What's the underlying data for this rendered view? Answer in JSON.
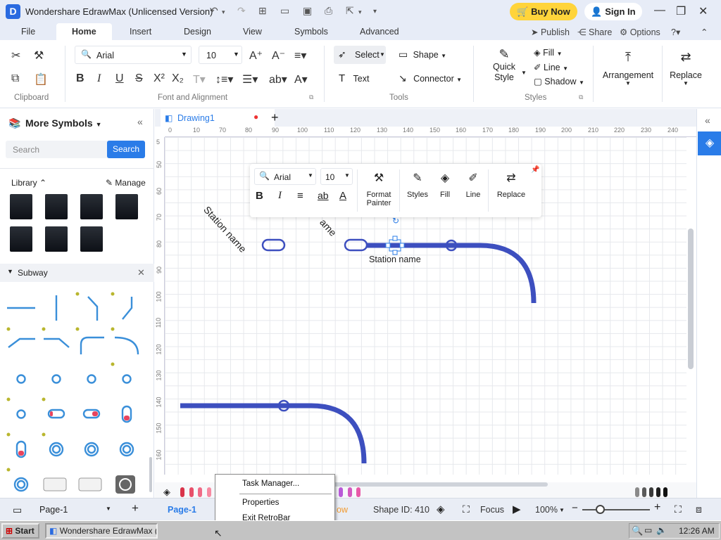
{
  "titlebar": {
    "app_title": "Wondershare EdrawMax (Unlicensed Version)",
    "buy_now": "Buy Now",
    "sign_in": "Sign In"
  },
  "menu": {
    "tabs": [
      "File",
      "Home",
      "Insert",
      "Design",
      "View",
      "Symbols",
      "Advanced"
    ],
    "active": "Home",
    "publish": "Publish",
    "share": "Share",
    "options": "Options"
  },
  "ribbon": {
    "font_name": "Arial",
    "font_size": "10",
    "select": "Select",
    "shape": "Shape",
    "text": "Text",
    "connector": "Connector",
    "quick_style": "Quick Style",
    "fill": "Fill",
    "line": "Line",
    "shadow": "Shadow",
    "arrangement": "Arrangement",
    "replace": "Replace",
    "groups": {
      "clipboard": "Clipboard",
      "font": "Font and Alignment",
      "tools": "Tools",
      "styles": "Styles"
    }
  },
  "leftpanel": {
    "title": "More Symbols",
    "search_placeholder": "Search",
    "search_button": "Search",
    "library": "Library",
    "manage": "Manage",
    "category": "Subway"
  },
  "document": {
    "tab_name": "Drawing1",
    "ruler_h": [
      "0",
      "10",
      "70",
      "80",
      "90",
      "100",
      "110",
      "120",
      "130",
      "140",
      "150",
      "160",
      "170",
      "180",
      "190",
      "200",
      "210",
      "220",
      "230",
      "240"
    ],
    "ruler_v": [
      "5",
      "50",
      "60",
      "70",
      "80",
      "90",
      "100",
      "110",
      "120",
      "130",
      "140",
      "150",
      "160"
    ],
    "station_label_1": "Station name",
    "station_label_2": "ame",
    "station_label_3": "Station name"
  },
  "floatbar": {
    "font_name": "Arial",
    "font_size": "10",
    "format_painter": "Format Painter",
    "styles": "Styles",
    "fill": "Fill",
    "line": "Line",
    "replace": "Replace"
  },
  "statusbar": {
    "page_select": "Page-1",
    "page_tab": "Page-1",
    "shape_id": "Shape ID: 410",
    "focus": "Focus",
    "zoom": "100%",
    "partial_text": "ow"
  },
  "context_menu": {
    "items": [
      "Task Manager...",
      "Properties",
      "Exit RetroBar"
    ]
  },
  "taskbar": {
    "start": "Start",
    "window": "Wondershare EdrawMax (...",
    "clock": "12:26 AM"
  },
  "colors": {
    "accent": "#2a7ce8",
    "subway_line": "#3d4fbf",
    "buy_now_bg": "#ffd43b",
    "palette": [
      "#d9344a",
      "#e8506a",
      "#f06b87",
      "#f78aa2",
      "#c44e6e",
      "#ff9f3a",
      "#ffc04d",
      "#f2e14e",
      "#d8f05e",
      "#a6e06a",
      "#6fd67a",
      "#44c9a0",
      "#36c4c9",
      "#4ab0e8",
      "#4d8ef0",
      "#5a6ff0",
      "#7a5af0",
      "#9a5ae8",
      "#b95ad8",
      "#d45ac0",
      "#e85aa8",
      "#8a8a8a",
      "#5a5a5a",
      "#3a3a3a",
      "#1e1e1e",
      "#111111"
    ]
  }
}
